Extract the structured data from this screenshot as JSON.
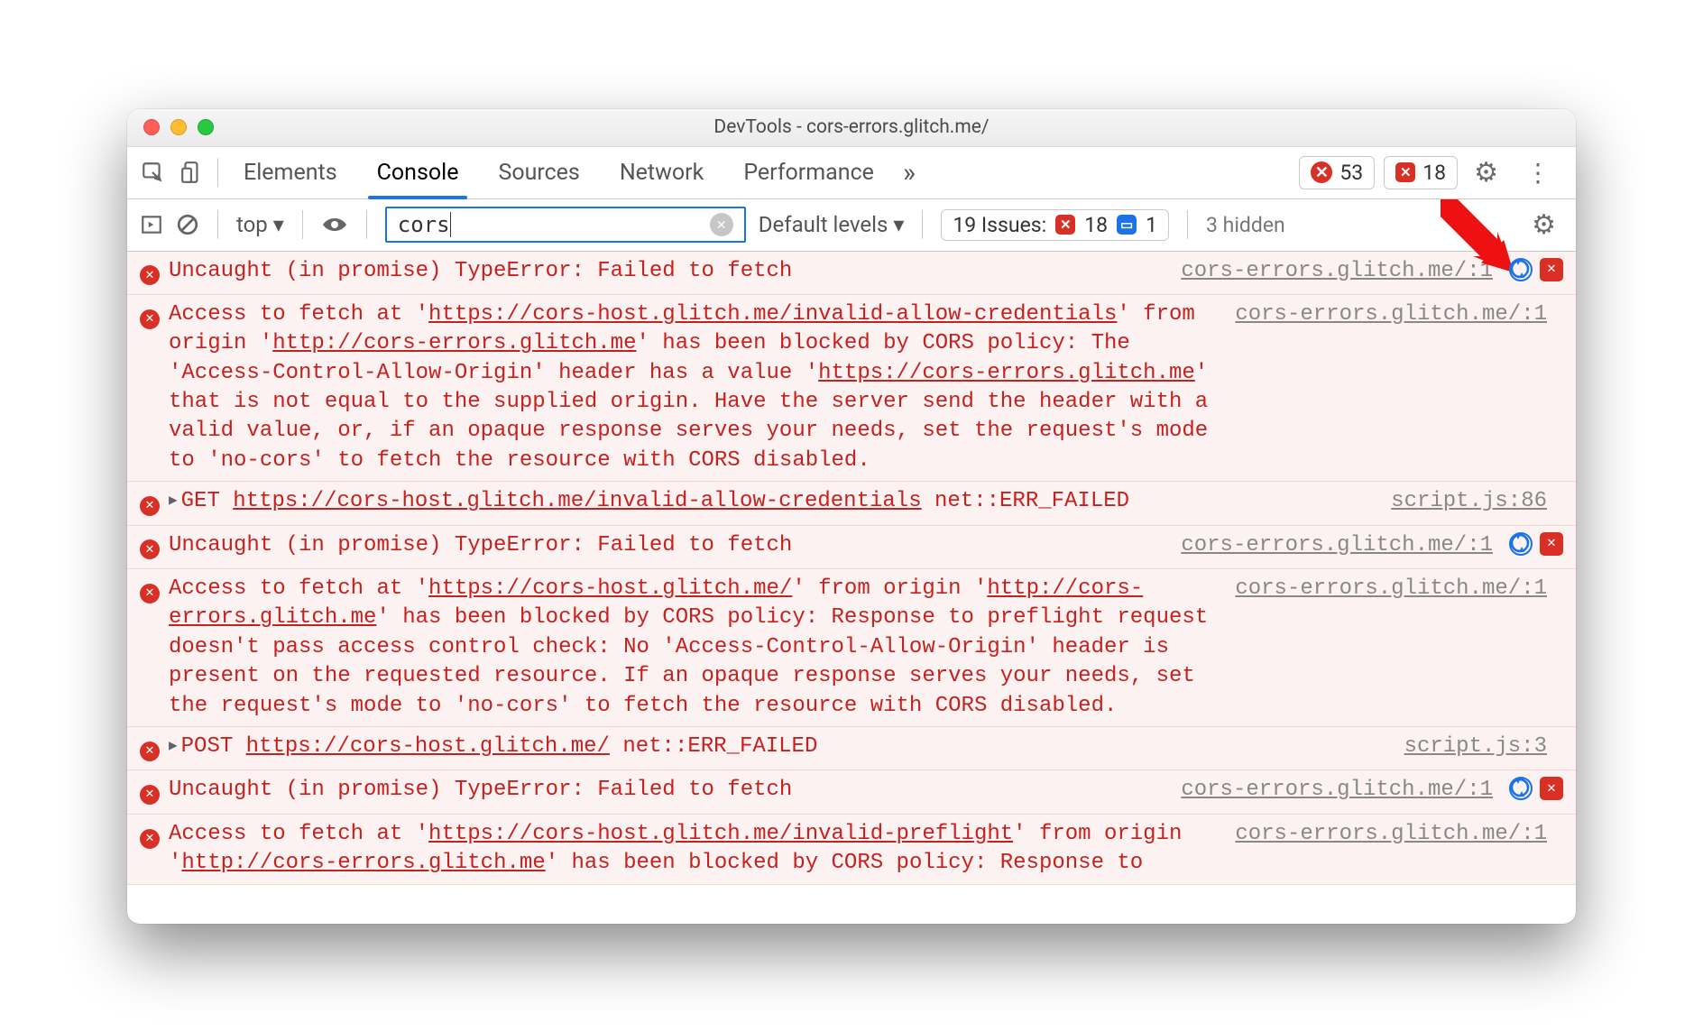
{
  "window": {
    "title": "DevTools - cors-errors.glitch.me/"
  },
  "tabs": {
    "items": [
      "Elements",
      "Console",
      "Sources",
      "Network",
      "Performance"
    ],
    "more": "»",
    "errors_count": "53",
    "issues_count": "18"
  },
  "consolebar": {
    "context": "top ▾",
    "filter_value": "cors",
    "levels": "Default levels ▾",
    "issues_label": "19 Issues:",
    "issues_err": "18",
    "issues_info": "1",
    "hidden": "3 hidden"
  },
  "messages": [
    {
      "type": "uncaught",
      "text": "Uncaught (in promise) TypeError: Failed to fetch",
      "source": "cors-errors.glitch.me/:1",
      "tail": true
    },
    {
      "type": "cors",
      "parts": [
        "Access to fetch at '",
        {
          "u": "https://cors-host.glitch.me/invalid-allow-credentials"
        },
        "' from origin '",
        {
          "u": "http://cors-errors.glitch.me"
        },
        "' has been blocked by CORS policy: The 'Access-Control-Allow-Origin' header has a value '",
        {
          "u": "https://cors-errors.glitch.me"
        },
        "' that is not equal to the supplied origin. Have the server send the header with a valid value, or, if an opaque response serves your needs, set the request's mode to 'no-cors' to fetch the resource with CORS disabled."
      ],
      "source": "cors-errors.glitch.me/:1"
    },
    {
      "type": "net",
      "method": "GET",
      "url": "https://cors-host.glitch.me/invalid-allow-credentials",
      "err": "net::ERR_FAILED",
      "source": "script.js:86"
    },
    {
      "type": "uncaught",
      "text": "Uncaught (in promise) TypeError: Failed to fetch",
      "source": "cors-errors.glitch.me/:1",
      "tail": true
    },
    {
      "type": "cors",
      "parts": [
        "Access to fetch at '",
        {
          "u": "https://cors-host.glitch.me/"
        },
        "' from origin '",
        {
          "u": "http://cors-errors.glitch.me"
        },
        "' has been blocked by CORS policy: Response to preflight request doesn't pass access control check: No 'Access-Control-Allow-Origin' header is present on the requested resource. If an opaque response serves your needs, set the request's mode to 'no-cors' to fetch the resource with CORS disabled."
      ],
      "source": "cors-errors.glitch.me/:1"
    },
    {
      "type": "net",
      "method": "POST",
      "url": "https://cors-host.glitch.me/",
      "err": "net::ERR_FAILED",
      "source": "script.js:3"
    },
    {
      "type": "uncaught",
      "text": "Uncaught (in promise) TypeError: Failed to fetch",
      "source": "cors-errors.glitch.me/:1",
      "tail": true
    },
    {
      "type": "cors",
      "parts": [
        "Access to fetch at '",
        {
          "u": "https://cors-host.glitch.me/invalid-preflight"
        },
        "' from origin '",
        {
          "u": "http://cors-errors.glitch.me"
        },
        "' has been blocked by CORS policy: Response to"
      ],
      "source": "cors-errors.glitch.me/:1"
    }
  ]
}
